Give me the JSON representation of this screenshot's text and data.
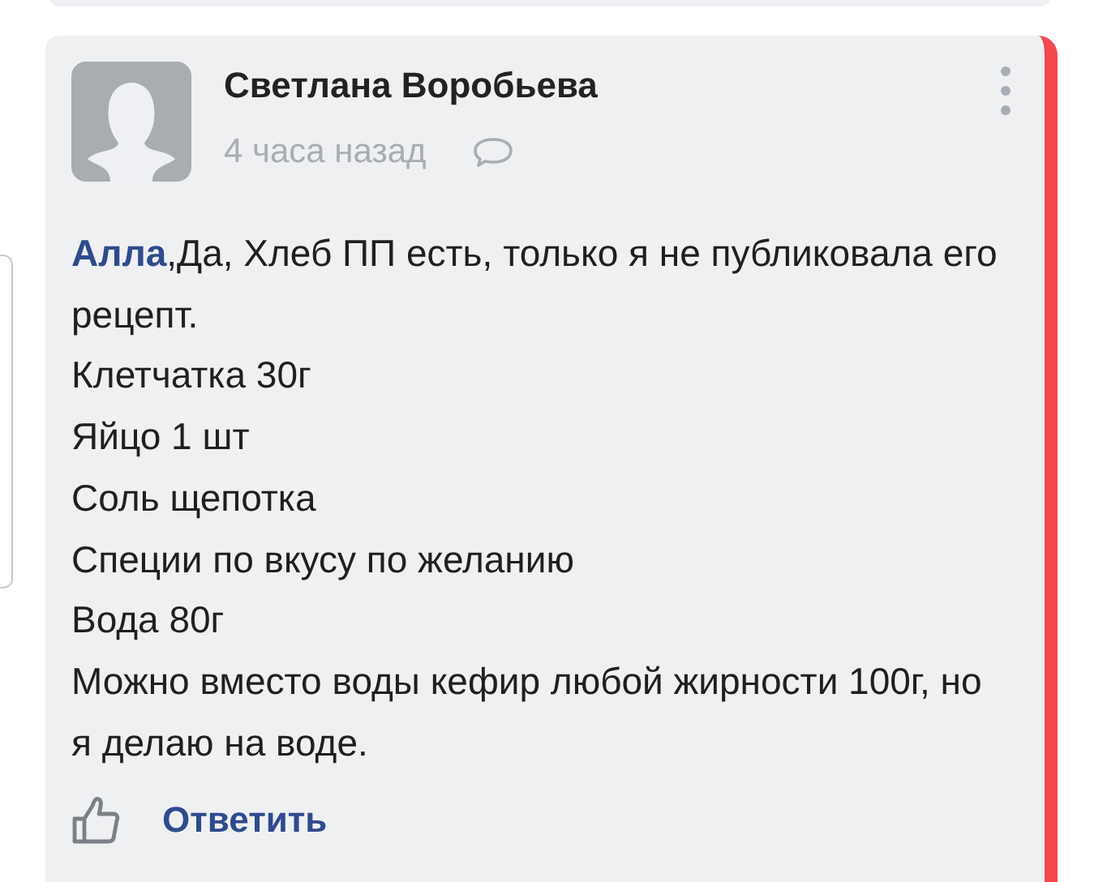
{
  "comment": {
    "author": "Светлана Воробьева",
    "time": "4 часа назад",
    "highlighted": true,
    "mention": "Алла",
    "paragraphs": [
      ",Да, Хлеб ПП есть, только я не публиковала его рецепт.",
      "Клетчатка 30г",
      "Яйцо 1 шт",
      "Соль щепотка",
      "Специи по вкусу по желанию",
      "Вода 80г",
      "Можно вместо воды кефир любой жирности 100г, но я делаю на воде."
    ],
    "reply_label": "Ответить"
  }
}
